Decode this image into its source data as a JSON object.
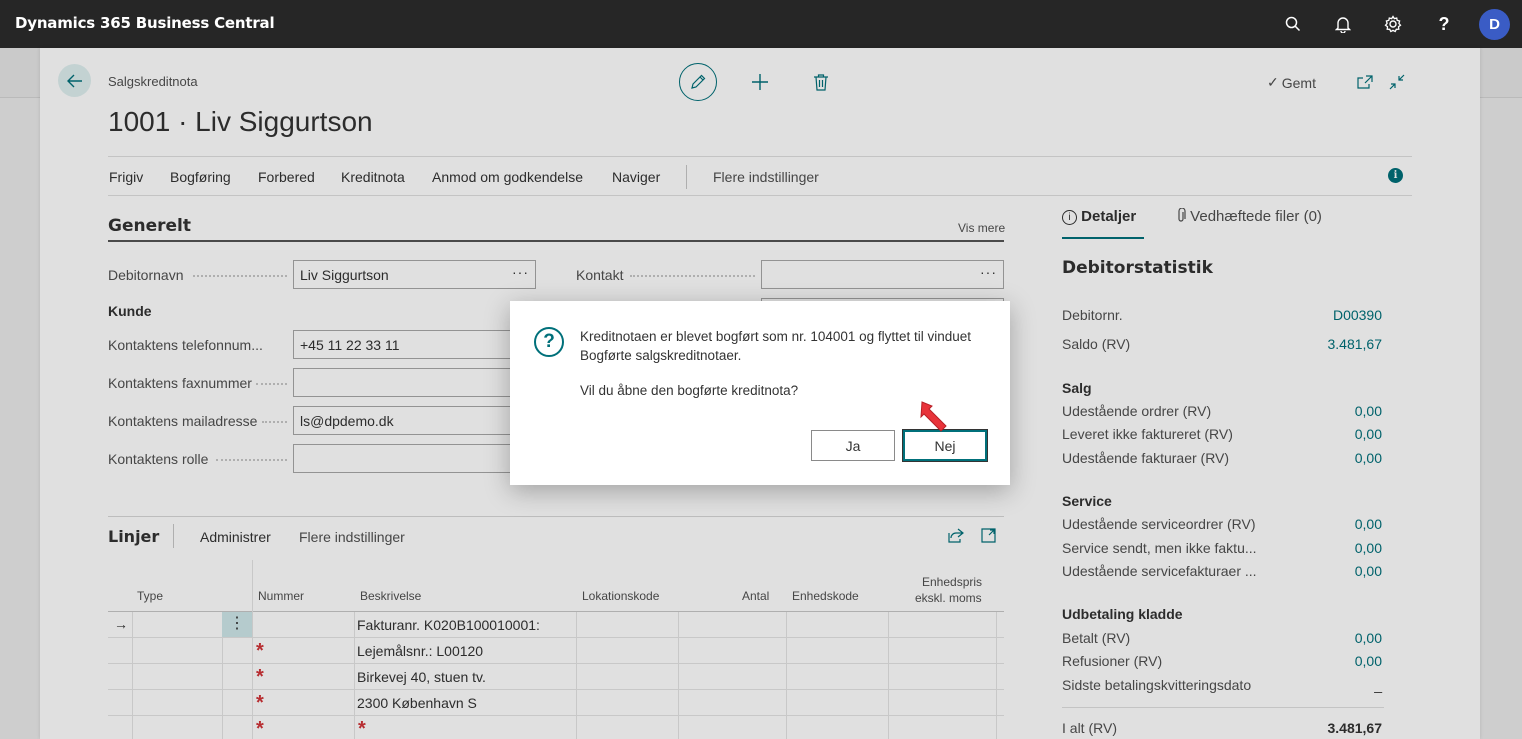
{
  "app": {
    "title": "Dynamics 365 Business Central",
    "user_initial": "D"
  },
  "page": {
    "caption": "Salgskreditnota",
    "title": "1001 · Liv Siggurtson",
    "saved_label": "Gemt"
  },
  "actions": [
    "Frigiv",
    "Bogføring",
    "Forbered",
    "Kreditnota",
    "Anmod om godkendelse",
    "Naviger",
    "Flere indstillinger"
  ],
  "general": {
    "title": "Generelt",
    "show_more": "Vis mere",
    "customer_name_label": "Debitornavn",
    "customer_name_value": "Liv Siggurtson",
    "contact_label": "Kontakt",
    "contact_value": "",
    "customer_group": "Kunde",
    "phone_label": "Kontaktens telefonnum...",
    "phone_value": "+45 11 22 33 11",
    "fax_label": "Kontaktens faxnummer",
    "fax_value": "",
    "email_label": "Kontaktens mailadresse",
    "email_value": "ls@dpdemo.dk",
    "role_label": "Kontaktens rolle",
    "role_value": ""
  },
  "lines": {
    "title": "Linjer",
    "actions": [
      "Administrer",
      "Flere indstillinger"
    ],
    "columns": {
      "type": "Type",
      "number": "Nummer",
      "description": "Beskrivelse",
      "location": "Lokationskode",
      "quantity": "Antal",
      "unit": "Enhedskode",
      "unit_price_1": "Enhedspris",
      "unit_price_2": "ekskl. moms"
    },
    "rows": [
      "Fakturanr. K020B100010001:",
      "Lejemålsnr.: L00120",
      "Birkevej 40, stuen tv.",
      "2300 København S",
      ""
    ]
  },
  "factbox": {
    "tab_details": "Detaljer",
    "tab_attachments": "Vedhæftede filer (0)",
    "title": "Debitorstatistik",
    "customer_no_label": "Debitornr.",
    "customer_no_value": "D00390",
    "balance_label": "Saldo (RV)",
    "balance_value": "3.481,67",
    "sales_title": "Salg",
    "sales": [
      {
        "label": "Udestående ordrer (RV)",
        "value": "0,00"
      },
      {
        "label": "Leveret ikke faktureret (RV)",
        "value": "0,00"
      },
      {
        "label": "Udestående fakturaer (RV)",
        "value": "0,00"
      }
    ],
    "service_title": "Service",
    "service": [
      {
        "label": "Udestående serviceordrer (RV)",
        "value": "0,00"
      },
      {
        "label": "Service sendt, men ikke faktu...",
        "value": "0,00"
      },
      {
        "label": "Udestående servicefakturaer ...",
        "value": "0,00"
      }
    ],
    "payments_title": "Udbetaling kladde",
    "payments": [
      {
        "label": "Betalt (RV)",
        "value": "0,00"
      },
      {
        "label": "Refusioner (RV)",
        "value": "0,00"
      },
      {
        "label": "Sidste betalingskvitteringsdato",
        "value": "_"
      }
    ],
    "total_label": "I alt (RV)",
    "total_value": "3.481,67"
  },
  "dialog": {
    "message": "Kreditnotaen er blevet bogført som nr. 104001 og flyttet til vinduet Bogførte salgskreditnotaer.",
    "question": "Vil du åbne den bogførte kreditnota?",
    "yes": "Ja",
    "no": "Nej"
  },
  "colors": {
    "accent": "#00707a",
    "topbar": "#262626",
    "required": "#d13438",
    "pointer": "#e8333a"
  }
}
